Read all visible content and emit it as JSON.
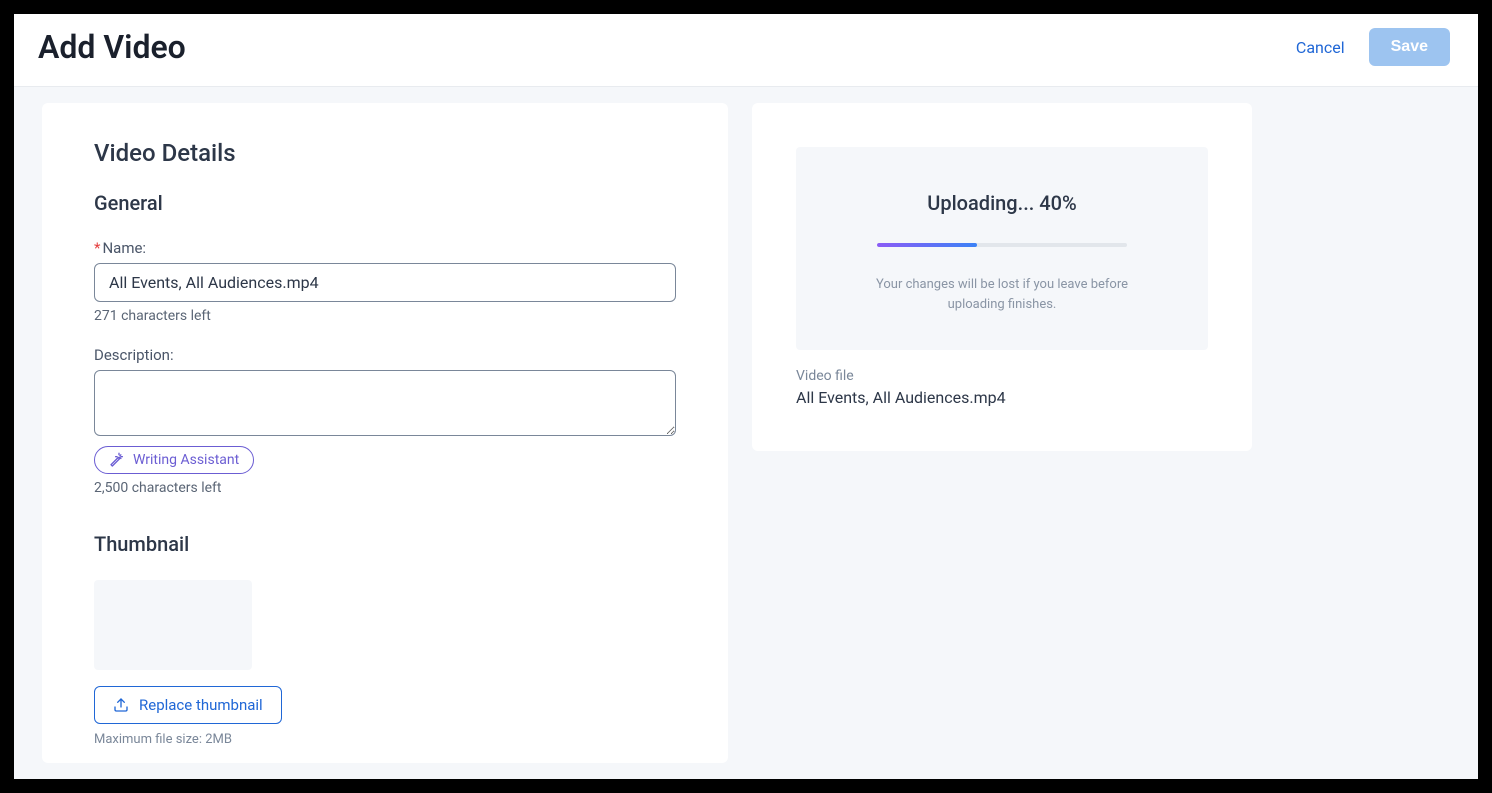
{
  "header": {
    "title": "Add Video",
    "cancel_label": "Cancel",
    "save_label": "Save"
  },
  "details": {
    "section_title": "Video Details",
    "general": {
      "title": "General",
      "name_label": "Name:",
      "name_value": "All Events, All Audiences.mp4",
      "name_helper": "271 characters left",
      "description_label": "Description:",
      "description_value": "",
      "writing_assistant_label": "Writing Assistant",
      "description_helper": "2,500 characters left"
    },
    "thumbnail": {
      "title": "Thumbnail",
      "replace_label": "Replace thumbnail",
      "max_size": "Maximum file size: 2MB"
    }
  },
  "upload": {
    "status_text": "Uploading... 40%",
    "progress_percent": 40,
    "warning_text": "Your changes will be lost if you leave before uploading finishes.",
    "file_label": "Video file",
    "file_name": "All Events, All Audiences.mp4"
  }
}
